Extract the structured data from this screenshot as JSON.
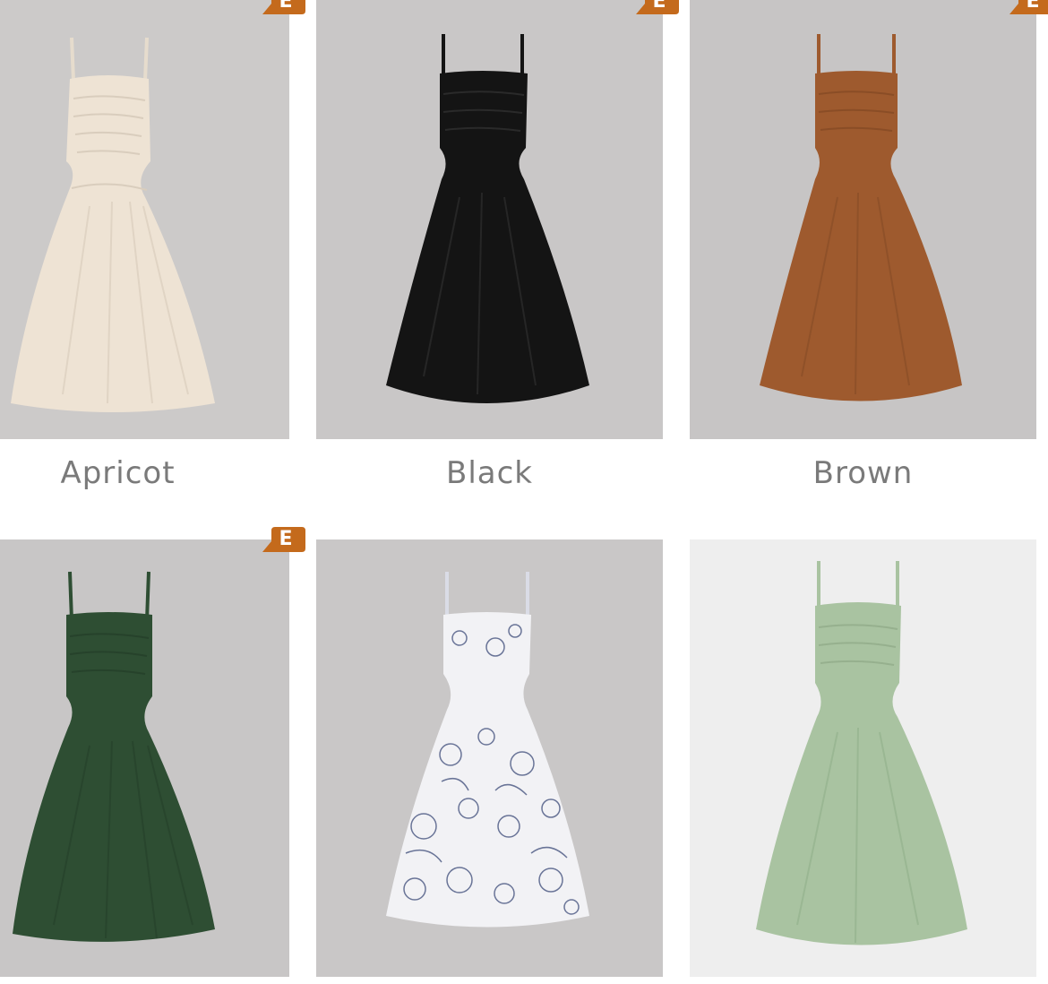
{
  "products": [
    {
      "color_name": "Apricot",
      "dress_color": "#EEE3D4",
      "bg": "#CCCAC9",
      "badge": "E"
    },
    {
      "color_name": "Black",
      "dress_color": "#141414",
      "bg": "#C9C7C7",
      "badge": "E"
    },
    {
      "color_name": "Brown",
      "dress_color": "#9E5A2E",
      "bg": "#C7C5C5",
      "badge": "E"
    },
    {
      "color_name": "",
      "dress_color": "#2E4E33",
      "bg": "#C8C6C6",
      "badge": "E"
    },
    {
      "color_name": "",
      "dress_color": "#F2F2F5",
      "bg": "#C9C7C7",
      "pattern": "floral",
      "pattern_color": "#3C4A78"
    },
    {
      "color_name": "",
      "dress_color": "#A9C3A1",
      "bg": "#EEEEEE"
    }
  ],
  "badge_color": "#C46A1C"
}
